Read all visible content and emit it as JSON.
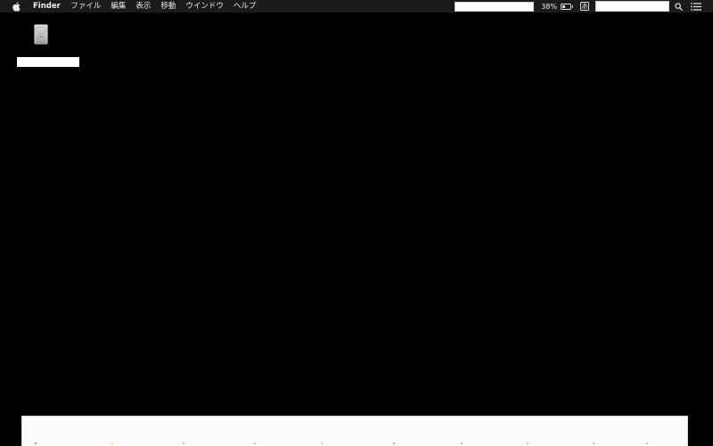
{
  "menubar": {
    "apple_icon": "apple-icon",
    "app_name": "Finder",
    "menus": [
      "ファイル",
      "編集",
      "表示",
      "移動",
      "ウインドウ",
      "ヘルプ"
    ],
    "status": {
      "battery_percent_text": "38%",
      "battery_level": 0.38,
      "input_method_label": "あ",
      "spotlight_icon": "magnifier-icon",
      "notification_icon": "notification-list-icon"
    }
  },
  "desktop": {
    "items": [
      {
        "icon": "hard-disk-icon",
        "label": ""
      }
    ]
  },
  "dock": {
    "items": []
  },
  "colors": {
    "menubar_bg": "#1b1b1b",
    "desktop_bg": "#000000",
    "dock_bg": "#fcfcfc"
  }
}
